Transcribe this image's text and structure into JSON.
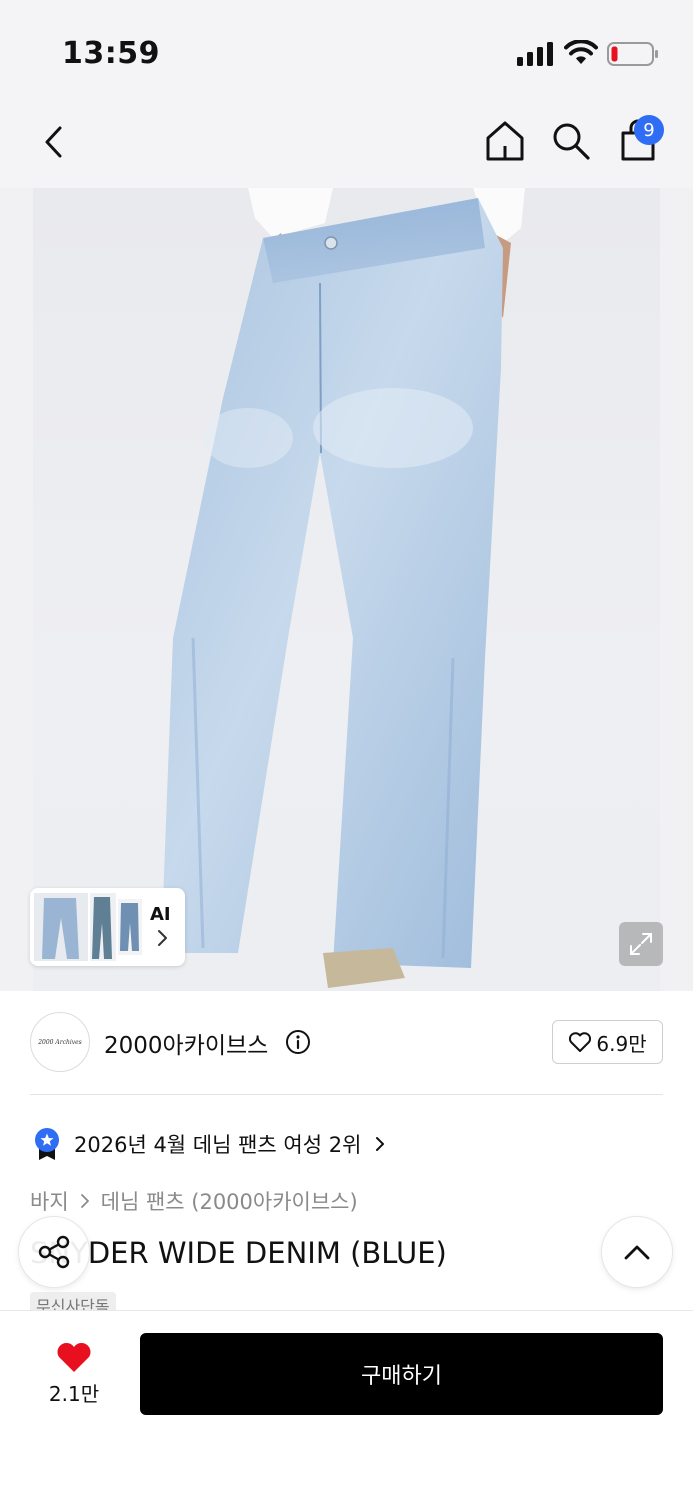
{
  "status_bar": {
    "time": "13:59"
  },
  "nav": {
    "back_icon": "chevron-left-icon",
    "home_icon": "home-icon",
    "search_icon": "search-icon",
    "cart_icon": "shopping-bag-icon",
    "cart_badge": "9",
    "badge_color": "#2f6df5"
  },
  "gallery": {
    "ai_label": "AI",
    "expand_icon": "expand-icon"
  },
  "brand": {
    "logo_text": "2000 Archives",
    "name": "2000아카이브스",
    "info_icon": "info-icon",
    "like_count": "6.9만"
  },
  "ranking": {
    "text": "2026년 4월 데님 팬츠 여성 2위",
    "badge_color": "#2f6df5"
  },
  "breadcrumb": {
    "category": "바지",
    "subcategory": "데님 팬츠 (2000아카이브스)"
  },
  "product": {
    "title": "SNYDER WIDE DENIM (BLUE)",
    "tag": "무신사단독"
  },
  "bottom_bar": {
    "wish_count": "2.1만",
    "buy_label": "구매하기",
    "heart_color": "#e8101e"
  }
}
